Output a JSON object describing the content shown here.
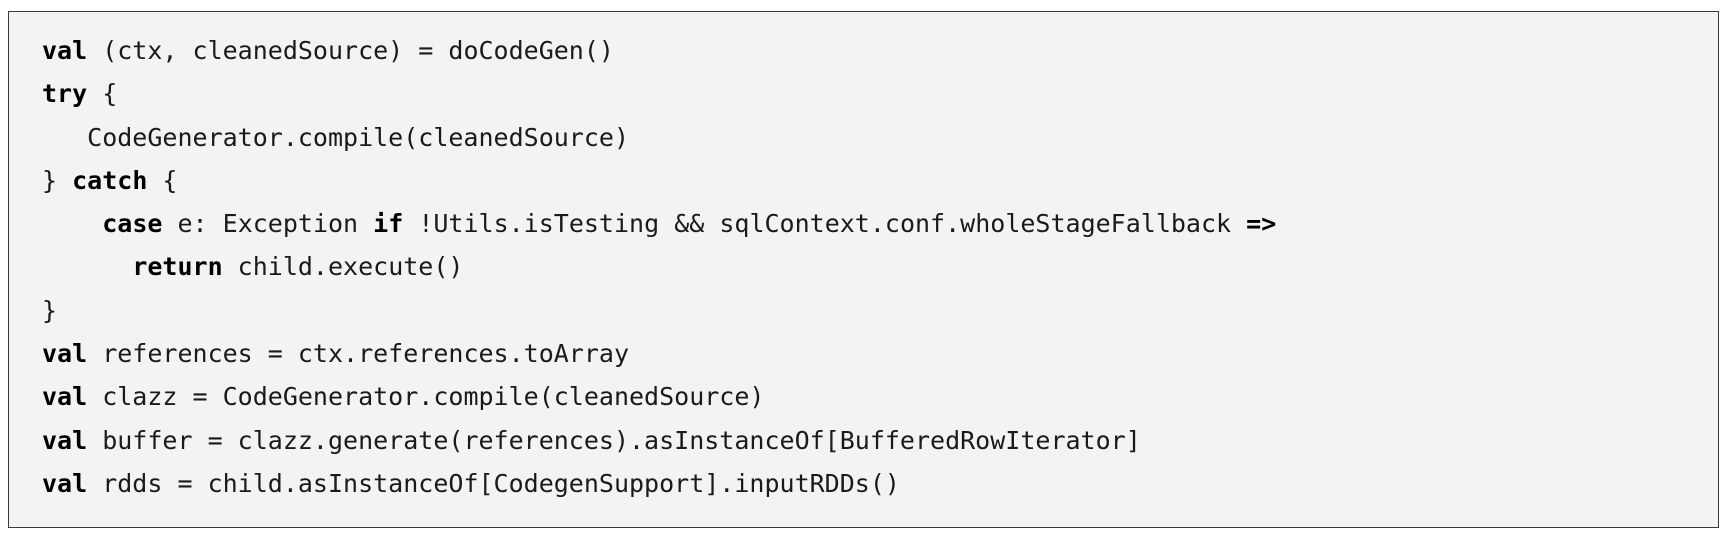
{
  "code_block": {
    "lines": [
      [
        {
          "t": "val",
          "kw": true
        },
        {
          "t": " (ctx, cleanedSource) = doCodeGen()"
        }
      ],
      [
        {
          "t": "try",
          "kw": true
        },
        {
          "t": " {"
        }
      ],
      [
        {
          "t": "   CodeGenerator.compile(cleanedSource)"
        }
      ],
      [
        {
          "t": "} "
        },
        {
          "t": "catch",
          "kw": true
        },
        {
          "t": " {"
        }
      ],
      [
        {
          "t": "    "
        },
        {
          "t": "case",
          "kw": true
        },
        {
          "t": " e: Exception "
        },
        {
          "t": "if",
          "kw": true
        },
        {
          "t": " !Utils.isTesting && sqlContext.conf.wholeStageFallback "
        },
        {
          "t": "=>",
          "kw": true
        }
      ],
      [
        {
          "t": "      "
        },
        {
          "t": "return",
          "kw": true
        },
        {
          "t": " child.execute()"
        }
      ],
      [
        {
          "t": "}"
        }
      ],
      [
        {
          "t": "val",
          "kw": true
        },
        {
          "t": " references = ctx.references.toArray"
        }
      ],
      [
        {
          "t": "val",
          "kw": true
        },
        {
          "t": " clazz = CodeGenerator.compile(cleanedSource)"
        }
      ],
      [
        {
          "t": "val",
          "kw": true
        },
        {
          "t": " buffer = clazz.generate(references).asInstanceOf[BufferedRowIterator]"
        }
      ],
      [
        {
          "t": "val",
          "kw": true
        },
        {
          "t": " rdds = child.asInstanceOf[CodegenSupport].inputRDDs()"
        }
      ]
    ]
  }
}
